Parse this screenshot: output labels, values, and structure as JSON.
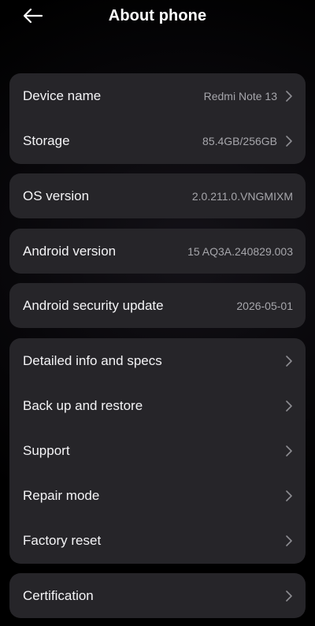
{
  "header": {
    "title": "About phone",
    "back_icon": "arrow-left-icon"
  },
  "groups": {
    "device": {
      "device_name": {
        "label": "Device name",
        "value": "Redmi Note 13"
      },
      "storage": {
        "label": "Storage",
        "value": "85.4GB/256GB"
      }
    },
    "os": {
      "label": "OS version",
      "value": "2.0.211.0.VNGMIXM"
    },
    "android": {
      "label": "Android version",
      "value": "15 AQ3A.240829.003"
    },
    "security": {
      "label": "Android security update",
      "value": "2026-05-01"
    },
    "actions": {
      "detailed": "Detailed info and specs",
      "backup": "Back up and restore",
      "support": "Support",
      "repair": "Repair mode",
      "factory": "Factory reset"
    },
    "certification": "Certification"
  },
  "colors": {
    "card": "#262529",
    "background": "#000000",
    "secondary_text": "#a6a6ab",
    "chevron": "#8d8d92"
  },
  "icons": {
    "chevron": "chevron-right-icon"
  }
}
